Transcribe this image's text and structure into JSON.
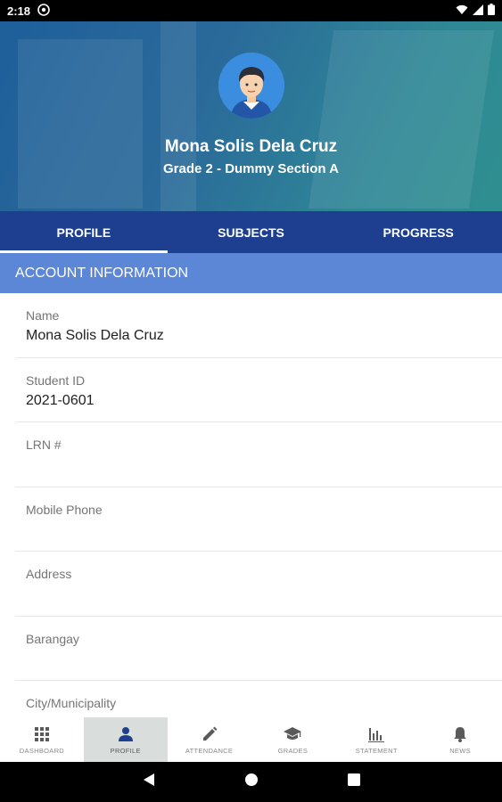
{
  "status_bar": {
    "time": "2:18"
  },
  "header": {
    "student_name": "Mona Solis Dela Cruz",
    "section": "Grade 2 - Dummy Section A"
  },
  "tabs": [
    {
      "label": "PROFILE",
      "active": true
    },
    {
      "label": "SUBJECTS",
      "active": false
    },
    {
      "label": "PROGRESS",
      "active": false
    }
  ],
  "account_info": {
    "title": "ACCOUNT INFORMATION",
    "fields": [
      {
        "label": "Name",
        "value": "Mona Solis Dela Cruz"
      },
      {
        "label": "Student ID",
        "value": "2021-0601"
      },
      {
        "label": "LRN #",
        "value": ""
      },
      {
        "label": "Mobile Phone",
        "value": ""
      },
      {
        "label": "Address",
        "value": ""
      },
      {
        "label": "Barangay",
        "value": ""
      },
      {
        "label": "City/Municipality",
        "value": ""
      }
    ]
  },
  "bottom_nav": [
    {
      "label": "DASHBOARD",
      "icon": "grid-icon",
      "active": false
    },
    {
      "label": "PROFILE",
      "icon": "person-icon",
      "active": true
    },
    {
      "label": "ATTENDANCE",
      "icon": "pencil-icon",
      "active": false
    },
    {
      "label": "GRADES",
      "icon": "graduation-cap-icon",
      "active": false
    },
    {
      "label": "STATEMENT",
      "icon": "bar-chart-icon",
      "active": false
    },
    {
      "label": "NEWS",
      "icon": "bell-icon",
      "active": false
    }
  ],
  "colors": {
    "tab_bar": "#1e3f8f",
    "section_header": "#5c86d6",
    "active_nav_bg": "#d9dedd"
  }
}
